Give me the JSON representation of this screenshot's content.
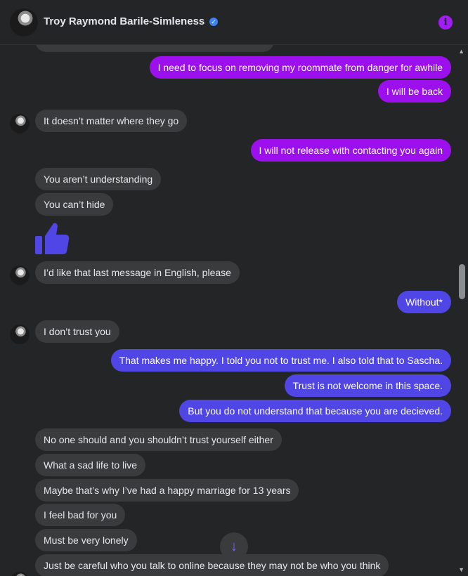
{
  "header": {
    "name": "Troy Raymond Barile-Simleness",
    "verified": "✓",
    "info": "i"
  },
  "colors": {
    "outgoing_purple": "#9b10ec",
    "outgoing_blue": "#4f46e5",
    "incoming": "#3a3b3c",
    "accent": "#a21cf5"
  },
  "messages": [
    {
      "from": "me",
      "text": "I need to focus on removing my roommate from danger for awhile"
    },
    {
      "from": "me",
      "text": "I will be back"
    },
    {
      "from": "them",
      "text": "It doesn’t matter where they go"
    },
    {
      "from": "me",
      "text": "I will not release with contacting you again"
    },
    {
      "from": "them",
      "text": "You aren’t understanding"
    },
    {
      "from": "them",
      "text": "You can’t hide"
    },
    {
      "from": "me",
      "text": "thumbs-up-icon"
    },
    {
      "from": "them",
      "text": "I’d like that last message in English, please"
    },
    {
      "from": "me",
      "text": "Without*"
    },
    {
      "from": "them",
      "text": "I don’t trust you"
    },
    {
      "from": "me",
      "text": "That makes me happy. I told you not to trust me. I also told that to Sascha."
    },
    {
      "from": "me",
      "text": "Trust is not welcome in this space."
    },
    {
      "from": "me",
      "text": "But you do not understand that because you are decieved."
    },
    {
      "from": "them",
      "text": "No one should and you shouldn’t trust yourself either"
    },
    {
      "from": "them",
      "text": "What a sad life to live"
    },
    {
      "from": "them",
      "text": "Maybe that’s why I’ve had a happy marriage for 13 years"
    },
    {
      "from": "them",
      "text": "I feel bad for you"
    },
    {
      "from": "them",
      "text": "Must be very lonely"
    },
    {
      "from": "them",
      "text": "Just be careful who you talk to online because they may not be who you think"
    }
  ],
  "icons": {
    "jump": "↓",
    "scroll_up": "▲",
    "scroll_down": "▼"
  }
}
